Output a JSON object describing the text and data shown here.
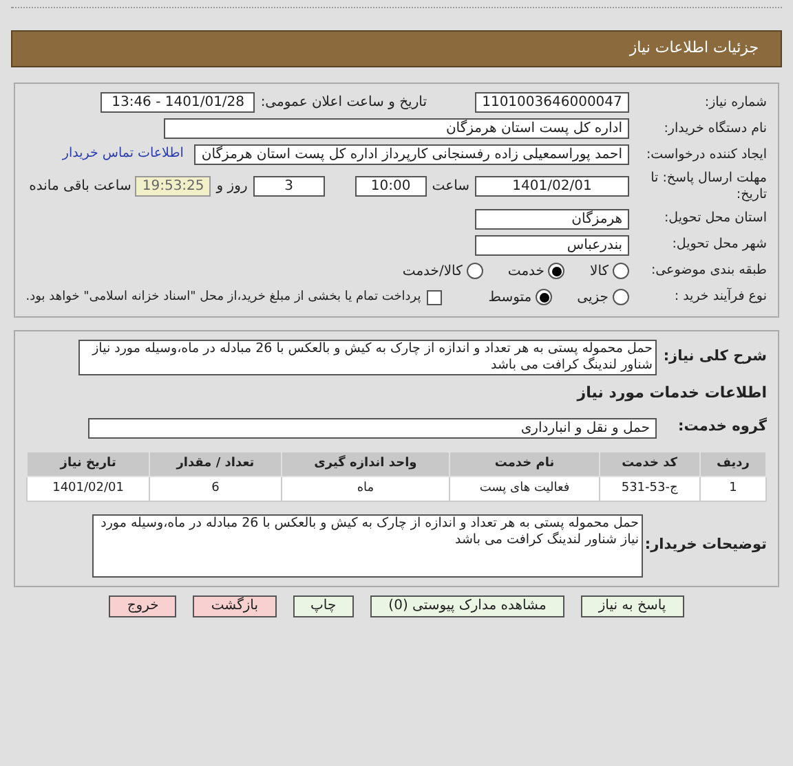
{
  "header": {
    "title": "جزئیات اطلاعات نیاز"
  },
  "need_number": {
    "label": "شماره نیاز:",
    "value": "1101003646000047"
  },
  "announce": {
    "label": "تاریخ و ساعت اعلان عمومی:",
    "value": "1401/01/28 - 13:46"
  },
  "buyer": {
    "label": "نام دستگاه خریدار:",
    "value": "اداره کل پست استان هرمزگان"
  },
  "requester": {
    "label": "ایجاد کننده درخواست:",
    "value": "احمد پوراسمعیلی زاده رفسنجانی کارپرداز اداره کل پست استان هرمزگان",
    "link": "اطلاعات تماس خریدار"
  },
  "deadline": {
    "label": "مهلت ارسال پاسخ: تا تاریخ:",
    "date": "1401/02/01",
    "time_label": "ساعت",
    "time": "10:00",
    "days": "3",
    "days_label": "روز و",
    "remaining": "19:53:25",
    "remaining_label": "ساعت باقی مانده"
  },
  "province": {
    "label": "استان محل تحویل:",
    "value": "هرمزگان"
  },
  "city": {
    "label": "شهر محل تحویل:",
    "value": "بندرعباس"
  },
  "category": {
    "label": "طبقه بندی موضوعی:",
    "options": [
      {
        "label": "کالا",
        "selected": false
      },
      {
        "label": "خدمت",
        "selected": true
      },
      {
        "label": "کالا/خدمت",
        "selected": false
      }
    ]
  },
  "process": {
    "label": "نوع فرآیند خرید :",
    "options": [
      {
        "label": "جزیی",
        "selected": false
      },
      {
        "label": "متوسط",
        "selected": true
      }
    ],
    "payment": {
      "checked": false,
      "label": "پرداخت تمام یا بخشی از مبلغ خرید،از محل \"اسناد خزانه اسلامی\" خواهد بود."
    }
  },
  "description": {
    "label": "شرح کلی نیاز:",
    "value": "حمل محموله پستی به هر تعداد و اندازه از چارک به کیش و بالعکس با 26 مبادله در ماه،وسیله مورد نیاز شناور لندینگ کرافت می باشد"
  },
  "services_title": "اطلاعات خدمات مورد نیاز",
  "service_group": {
    "label": "گروه خدمت:",
    "value": "حمل و نقل و انبارداری"
  },
  "table": {
    "columns": [
      "ردیف",
      "کد خدمت",
      "نام خدمت",
      "واحد اندازه گیری",
      "تعداد / مقدار",
      "تاریخ نیاز"
    ],
    "rows": [
      [
        "1",
        "ج-53-531",
        "فعالیت های پست",
        "ماه",
        "6",
        "1401/02/01"
      ]
    ]
  },
  "buyer_notes": {
    "label": "توضیحات خریدار:",
    "value": "حمل محموله پستی به هر تعداد و اندازه از چارک به کیش و بالعکس با 26 مبادله در ماه،وسیله مورد نیاز شناور لندینگ کرافت می باشد"
  },
  "buttons": [
    {
      "label": "پاسخ به نیاز",
      "kind": "normal"
    },
    {
      "label": "مشاهده مدارک پیوستی (0)",
      "kind": "normal"
    },
    {
      "label": "چاپ",
      "kind": "normal"
    },
    {
      "label": "بازگشت",
      "kind": "danger"
    },
    {
      "label": "خروج",
      "kind": "danger"
    }
  ]
}
